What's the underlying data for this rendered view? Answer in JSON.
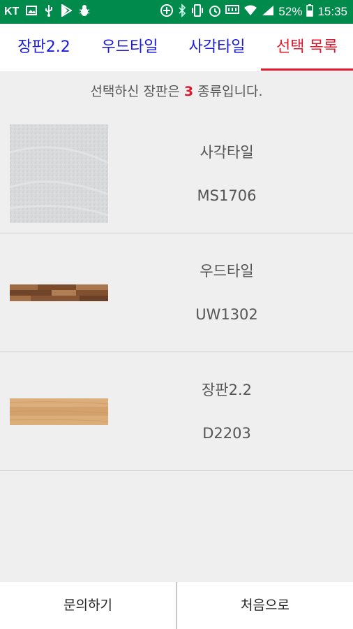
{
  "status_bar": {
    "carrier": "KT",
    "battery": "52%",
    "time": "15:35",
    "left_icons": [
      "image-icon",
      "usb-icon",
      "play-store-icon",
      "bug-icon"
    ],
    "right_icons": [
      "data-saver-icon",
      "bluetooth-icon",
      "vibrate-icon",
      "alarm-icon",
      "lte-icon",
      "wifi-icon",
      "signal-icon",
      "battery-icon"
    ],
    "bg_color": "#008a4c"
  },
  "tabs": [
    {
      "label": "장판2.2",
      "active": false
    },
    {
      "label": "우드타일",
      "active": false
    },
    {
      "label": "사각타일",
      "active": false
    },
    {
      "label": "선택 목록",
      "active": true
    }
  ],
  "colors": {
    "tab_inactive": "#1a1adb",
    "tab_active": "#e0182b",
    "accent_count": "#e0182b"
  },
  "summary": {
    "prefix": "선택하신 장판은 ",
    "count": "3",
    "suffix": " 종류입니다."
  },
  "items": [
    {
      "name": "사각타일",
      "code": "MS1706",
      "thumbnail": "gray-granite-texture"
    },
    {
      "name": "우드타일",
      "code": "UW1302",
      "thumbnail": "dark-wood-plank-texture"
    },
    {
      "name": "장판2.2",
      "code": "D2203",
      "thumbnail": "light-wood-texture"
    }
  ],
  "bottom_buttons": {
    "inquiry": "문의하기",
    "home": "처음으로"
  }
}
